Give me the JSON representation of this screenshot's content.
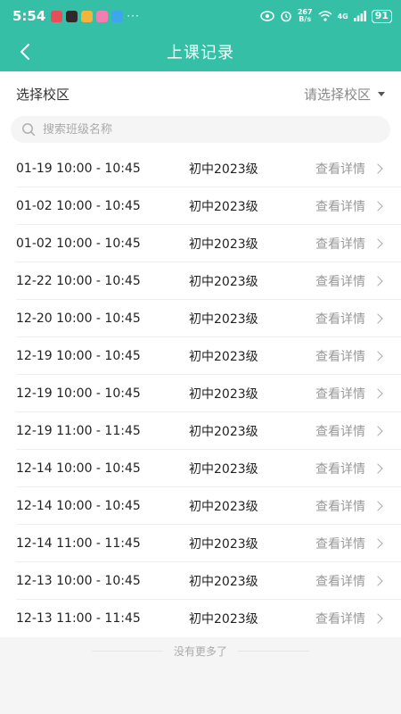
{
  "status": {
    "time": "5:54",
    "more": "···",
    "network": "267",
    "network_unit": "B/s",
    "signal": "4G",
    "battery": "91"
  },
  "header": {
    "title": "上课记录"
  },
  "filter": {
    "label": "选择校区",
    "select_placeholder": "请选择校区"
  },
  "search": {
    "placeholder": "搜索班级名称"
  },
  "records": [
    {
      "time": "01-19 10:00 - 10:45",
      "class": "初中2023级",
      "detail": "查看详情"
    },
    {
      "time": "01-02 10:00 - 10:45",
      "class": "初中2023级",
      "detail": "查看详情"
    },
    {
      "time": "01-02 10:00 - 10:45",
      "class": "初中2023级",
      "detail": "查看详情"
    },
    {
      "time": "12-22 10:00 - 10:45",
      "class": "初中2023级",
      "detail": "查看详情"
    },
    {
      "time": "12-20 10:00 - 10:45",
      "class": "初中2023级",
      "detail": "查看详情"
    },
    {
      "time": "12-19 10:00 - 10:45",
      "class": "初中2023级",
      "detail": "查看详情"
    },
    {
      "time": "12-19 10:00 - 10:45",
      "class": "初中2023级",
      "detail": "查看详情"
    },
    {
      "time": "12-19 11:00 - 11:45",
      "class": "初中2023级",
      "detail": "查看详情"
    },
    {
      "time": "12-14 10:00 - 10:45",
      "class": "初中2023级",
      "detail": "查看详情"
    },
    {
      "time": "12-14 10:00 - 10:45",
      "class": "初中2023级",
      "detail": "查看详情"
    },
    {
      "time": "12-14 11:00 - 11:45",
      "class": "初中2023级",
      "detail": "查看详情"
    },
    {
      "time": "12-13 10:00 - 10:45",
      "class": "初中2023级",
      "detail": "查看详情"
    },
    {
      "time": "12-13 11:00 - 11:45",
      "class": "初中2023级",
      "detail": "查看详情"
    }
  ],
  "footer": {
    "no_more": "没有更多了"
  },
  "colors": {
    "brand": "#34bfa6",
    "muted_text": "#999999"
  }
}
